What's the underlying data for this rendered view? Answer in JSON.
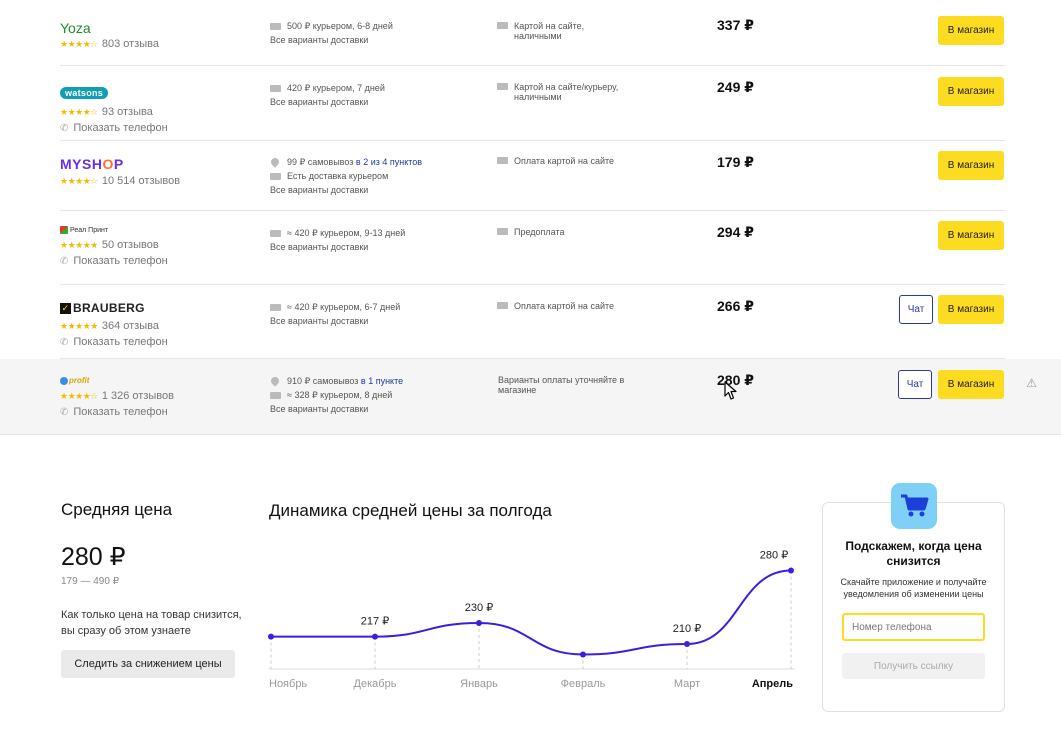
{
  "offers": [
    {
      "shop": "Yoza",
      "stars": "★★★★☆",
      "reviews": "803 отзыва",
      "phone": "",
      "delivery": [
        {
          "icon": "truck-icon",
          "text": "500 ₽ курьером, 6-8 дней",
          "link": ""
        }
      ],
      "delivery_all": "Все варианты доставки",
      "payment": "Картой на сайте, наличными",
      "price": "337 ₽",
      "chat": "",
      "button": "В магазин"
    },
    {
      "shop": "watsons",
      "stars": "★★★★☆",
      "reviews": "93 отзыва",
      "phone": "Показать телефон",
      "delivery": [
        {
          "icon": "truck-icon",
          "text": "420 ₽ курьером, 7 дней",
          "link": ""
        }
      ],
      "delivery_all": "Все варианты доставки",
      "payment": "Картой на сайте/курьеру, наличными",
      "price": "249 ₽",
      "chat": "",
      "button": "В магазин"
    },
    {
      "shop_a": "MYSH",
      "shop_b": "O",
      "shop_c": "P",
      "stars": "★★★★☆",
      "reviews": "10 514 отзывов",
      "phone": "",
      "delivery": [
        {
          "icon": "pin-icon",
          "text": "99 ₽ самовывоз ",
          "link": "в 2 из 4 пунктов"
        },
        {
          "icon": "truck-icon",
          "text": "Есть доставка курьером",
          "link": ""
        }
      ],
      "delivery_all": "Все варианты доставки",
      "payment": "Оплата картой на сайте",
      "price": "179 ₽",
      "chat": "",
      "button": "В магазин"
    },
    {
      "shop": "Реал Принт",
      "stars": "★★★★★",
      "reviews": "50 отзывов",
      "phone": "Показать телефон",
      "delivery": [
        {
          "icon": "truck-icon",
          "text": "≈ 420 ₽ курьером, 9-13 дней",
          "link": ""
        }
      ],
      "delivery_all": "Все варианты доставки",
      "payment": "Предоплата",
      "price": "294 ₽",
      "chat": "",
      "button": "В магазин"
    },
    {
      "shop": "BRAUBERG",
      "stars": "★★★★★",
      "reviews": "364 отзыва",
      "phone": "Показать телефон",
      "delivery": [
        {
          "icon": "truck-icon",
          "text": "≈ 420 ₽ курьером, 6-7 дней",
          "link": ""
        }
      ],
      "delivery_all": "Все варианты доставки",
      "payment": "Оплата картой на сайте",
      "price": "266 ₽",
      "chat": "Чат",
      "button": "В магазин"
    },
    {
      "shop": "profit",
      "stars": "★★★★☆",
      "reviews": "1 326 отзывов",
      "phone": "Показать телефон",
      "delivery": [
        {
          "icon": "pin-icon",
          "text": "910 ₽ самовывоз ",
          "link": "в 1 пункте"
        },
        {
          "icon": "truck-icon",
          "text": "≈ 328 ₽ курьером, 8 дней",
          "link": ""
        }
      ],
      "delivery_all": "Все варианты доставки",
      "payment": "Варианты оплаты уточняйте в магазине",
      "price": "280 ₽",
      "chat": "Чат",
      "button": "В магазин"
    }
  ],
  "average": {
    "title": "Средняя цена",
    "price": "280 ₽",
    "range": "179 — 490 ₽",
    "text": "Как только цена на товар снизится, вы сразу об этом узнаете",
    "follow_button": "Следить за снижением цены"
  },
  "dynamics_title": "Динамика средней цены за полгода",
  "chart_data": {
    "type": "line",
    "categories": [
      "Ноябрь",
      "Декабрь",
      "Январь",
      "Февраль",
      "Март",
      "Апрель"
    ],
    "values": [
      217,
      217,
      230,
      200,
      210,
      280
    ],
    "point_labels": [
      "",
      "217 ₽",
      "230 ₽",
      "",
      "210 ₽",
      "280 ₽"
    ],
    "ylim": [
      190,
      290
    ],
    "active_category": "Апрель",
    "line_color": "#3b1fe0"
  },
  "promo": {
    "title": "Подскажем, когда цена снизится",
    "text": "Скачайте приложение и получайте уведомления об изменении цены",
    "phone_placeholder": "Номер телефона",
    "get_link": "Получить ссылку"
  },
  "colors": {
    "accent": "#fcdb20",
    "link": "#1a3c99"
  }
}
